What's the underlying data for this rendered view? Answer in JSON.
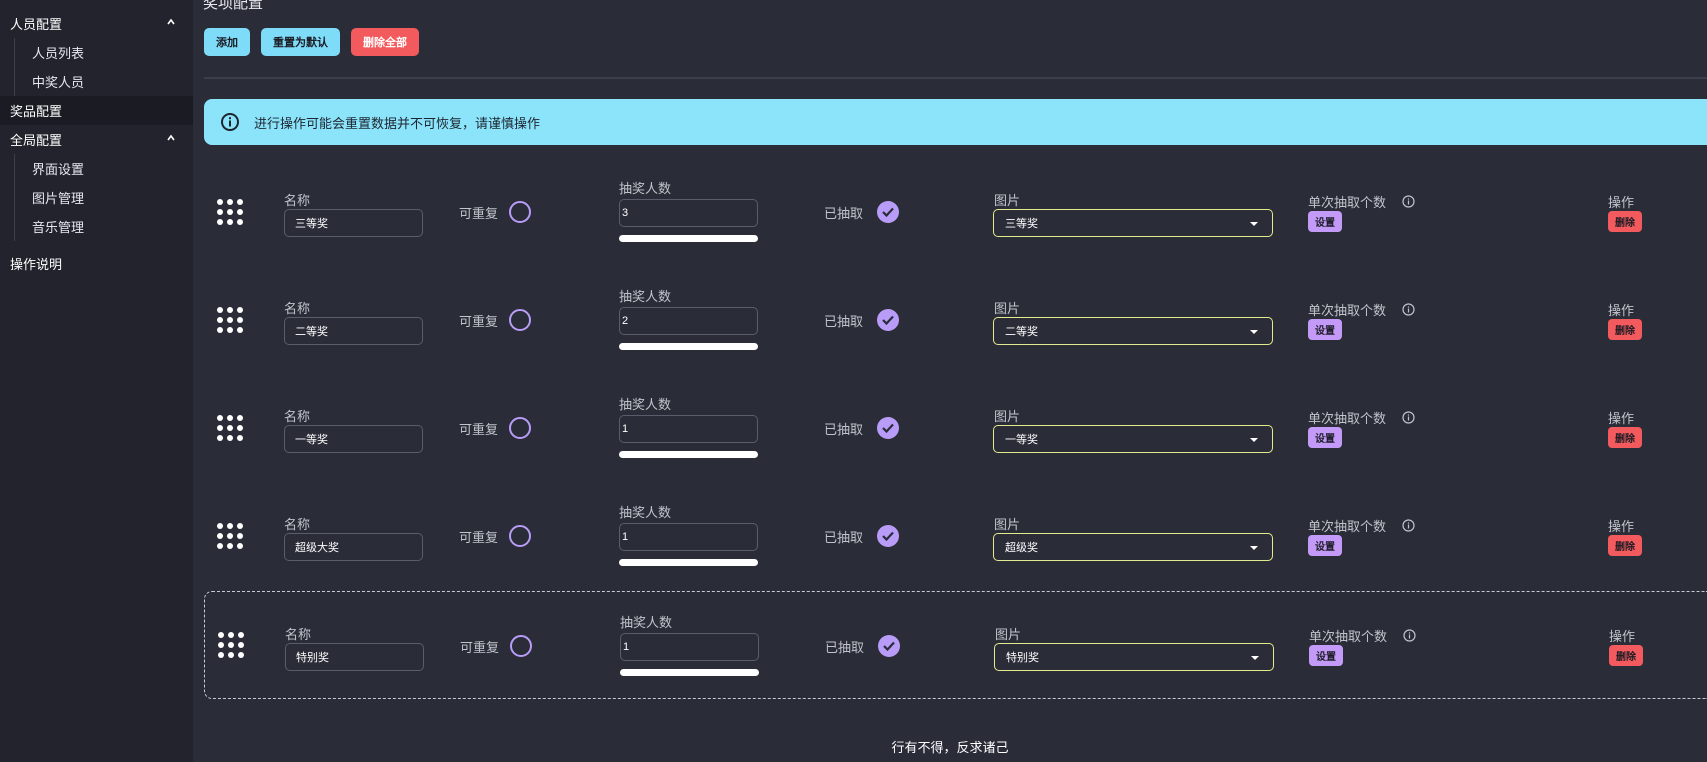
{
  "sidebar": {
    "groups": [
      {
        "label": "人员配置",
        "items": [
          "人员列表",
          "中奖人员"
        ]
      },
      {
        "label": "奖品配置"
      },
      {
        "label": "全局配置",
        "items": [
          "界面设置",
          "图片管理",
          "音乐管理"
        ]
      },
      {
        "label": "操作说明"
      }
    ]
  },
  "main": {
    "title": "奖项配置",
    "toolbar": {
      "add": "添加",
      "reset": "重置为默认",
      "delete_all": "删除全部"
    },
    "alert": "进行操作可能会重置数据并不可恢复，请谨慎操作",
    "labels": {
      "name": "名称",
      "repeatable": "可重复",
      "count": "抽奖人数",
      "drawn": "已抽取",
      "image": "图片",
      "per_draw": "单次抽取个数",
      "set": "设置",
      "action": "操作",
      "delete": "删除"
    },
    "prizes": [
      {
        "name": "三等奖",
        "count": "3",
        "image": "三等奖",
        "repeatable": false,
        "drawn": true
      },
      {
        "name": "二等奖",
        "count": "2",
        "image": "二等奖",
        "repeatable": false,
        "drawn": true
      },
      {
        "name": "一等奖",
        "count": "1",
        "image": "一等奖",
        "repeatable": false,
        "drawn": true
      },
      {
        "name": "超级大奖",
        "count": "1",
        "image": "超级奖",
        "repeatable": false,
        "drawn": true
      },
      {
        "name": "特别奖",
        "count": "1",
        "image": "特别奖",
        "repeatable": false,
        "drawn": true
      }
    ]
  },
  "footer": "行有不得，反求诸己",
  "colors": {
    "background": "#2a2c38",
    "sidebar": "#22232c",
    "cyan": "#7fdcf8",
    "red": "#f35a5e",
    "purple": "#b89cf7",
    "select_border": "#e4ea8e"
  }
}
